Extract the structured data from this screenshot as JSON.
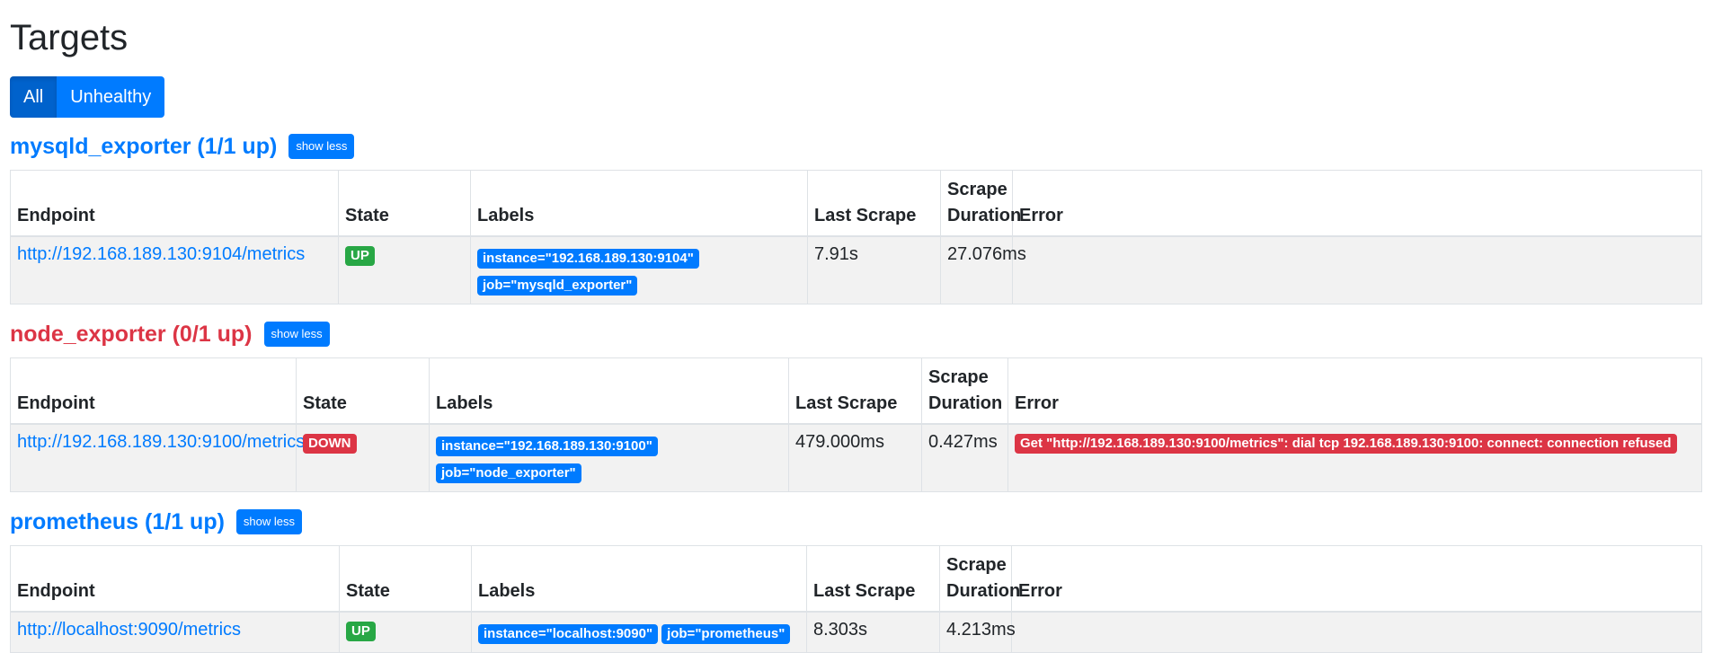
{
  "page": {
    "title": "Targets"
  },
  "filters": {
    "all_label": "All",
    "unhealthy_label": "Unhealthy"
  },
  "columns": {
    "endpoint": "Endpoint",
    "state": "State",
    "labels": "Labels",
    "last_scrape": "Last Scrape",
    "scrape_duration": "Scrape Duration",
    "error": "Error"
  },
  "pools": [
    {
      "title": "mysqld_exporter (1/1 up)",
      "show_less_label": "show less",
      "health": "ok",
      "rows": [
        {
          "endpoint": "http://192.168.189.130:9104/metrics",
          "state": "UP",
          "labels": [
            "instance=\"192.168.189.130:9104\"",
            "job=\"mysqld_exporter\""
          ],
          "last_scrape": "7.91s",
          "scrape_duration": "27.076ms",
          "error": ""
        }
      ]
    },
    {
      "title": "node_exporter (0/1 up)",
      "show_less_label": "show less",
      "health": "bad",
      "rows": [
        {
          "endpoint": "http://192.168.189.130:9100/metrics",
          "state": "DOWN",
          "labels": [
            "instance=\"192.168.189.130:9100\"",
            "job=\"node_exporter\""
          ],
          "last_scrape": "479.000ms",
          "scrape_duration": "0.427ms",
          "error": "Get \"http://192.168.189.130:9100/metrics\": dial tcp 192.168.189.130:9100: connect: connection refused"
        }
      ]
    },
    {
      "title": "prometheus (1/1 up)",
      "show_less_label": "show less",
      "health": "ok",
      "rows": [
        {
          "endpoint": "http://localhost:9090/metrics",
          "state": "UP",
          "labels": [
            "instance=\"localhost:9090\"",
            "job=\"prometheus\""
          ],
          "last_scrape": "8.303s",
          "scrape_duration": "4.213ms",
          "error": ""
        }
      ]
    }
  ]
}
